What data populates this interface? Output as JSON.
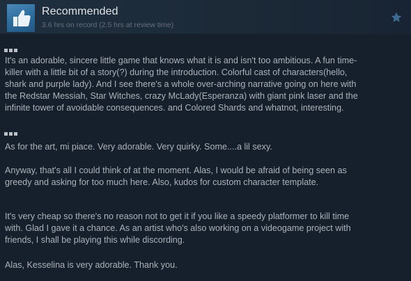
{
  "header": {
    "title": "Recommended",
    "hours_on_record": "3.6 hrs on record (2.5 hrs at review time)",
    "thumb_icon": "thumbs-up-icon",
    "star_icon": "star-icon",
    "accent_color": "#2f6b9a"
  },
  "review": {
    "paragraph_1": "It's an adorable, sincere little game that knows what it is and isn't too ambitious. A fun time-\nkiller with a little bit of a story(?) during the introduction. Colorful cast of characters(hello,\nshark and purple lady). And I see there's a whole over-arching narrative going on here with\nthe Redstar Messiah, Star Witches, crazy McLady(Esperanza) with giant pink laser and the\ninfinite tower of avoidable consequences. and Colored Shards and whatnot, interesting.",
    "paragraph_2": "As for the art, mi piace. Very adorable. Very quirky. Some....a lil sexy.",
    "paragraph_3": "Anyway, that's all I could think of at the moment. Alas, I would be afraid of being seen as\ngreedy and asking for too much here. Also, kudos for custom character template.",
    "paragraph_4": "It's very cheap so there's no reason not to get it if you like a speedy platformer to kill time\nwith. Glad I gave it a chance. As an artist who's also working on a videogame project with\nfriends, I shall be playing this while discording.",
    "paragraph_5": "Alas, Kesselina is very adorable. Thank you."
  }
}
